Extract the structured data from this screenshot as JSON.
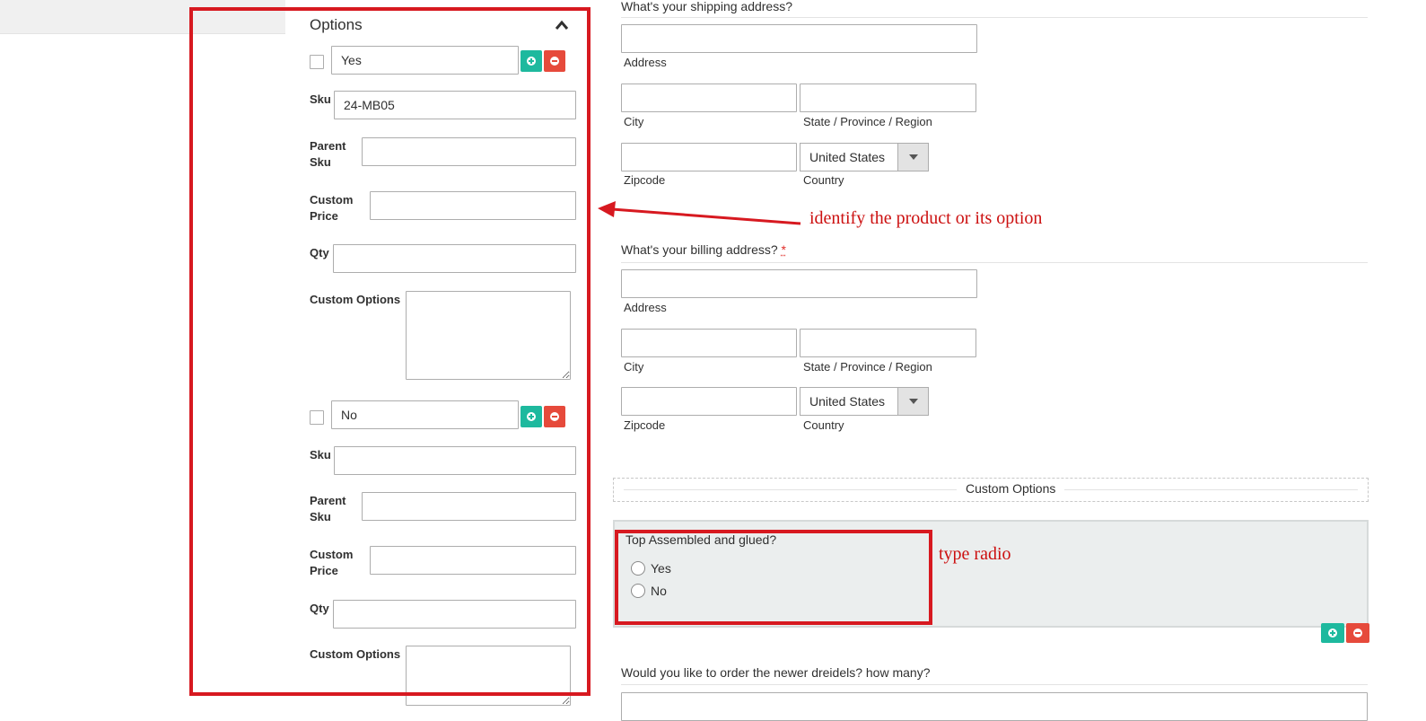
{
  "options_panel": {
    "title": "Options",
    "groups": [
      {
        "option_value": "Yes",
        "sku_label": "Sku",
        "sku_value": "24-MB05",
        "parent_sku_label_1": "Parent",
        "parent_sku_label_2": "Sku",
        "custom_price_label_1": "Custom",
        "custom_price_label_2": "Price",
        "qty_label": "Qty",
        "custom_options_label": "Custom Options"
      },
      {
        "option_value": "No",
        "sku_label": "Sku",
        "sku_value": "",
        "parent_sku_label_1": "Parent",
        "parent_sku_label_2": "Sku",
        "custom_price_label_1": "Custom",
        "custom_price_label_2": "Price",
        "qty_label": "Qty",
        "custom_options_label": "Custom Options"
      }
    ]
  },
  "shipping": {
    "question": "What's your shipping address?",
    "address_label": "Address",
    "city_label": "City",
    "region_label": "State / Province / Region",
    "zipcode_label": "Zipcode",
    "country_label": "Country",
    "country_value": "United States"
  },
  "billing": {
    "question": "What's your billing address?",
    "required_mark": "*",
    "address_label": "Address",
    "city_label": "City",
    "region_label": "State / Province / Region",
    "zipcode_label": "Zipcode",
    "country_label": "Country",
    "country_value": "United States"
  },
  "custom_options": {
    "legend": "Custom Options",
    "question": "Top Assembled and glued?",
    "radio_options": [
      "Yes",
      "No"
    ]
  },
  "dreidels": {
    "question": "Would you like to order the newer dreidels? how many?"
  },
  "annotations": {
    "arrow_note": "identify the product or its option",
    "radio_note": "type radio",
    "color": "#d71920"
  },
  "colors": {
    "add_button": "#1eb99e",
    "remove_button": "#e64a3b"
  }
}
